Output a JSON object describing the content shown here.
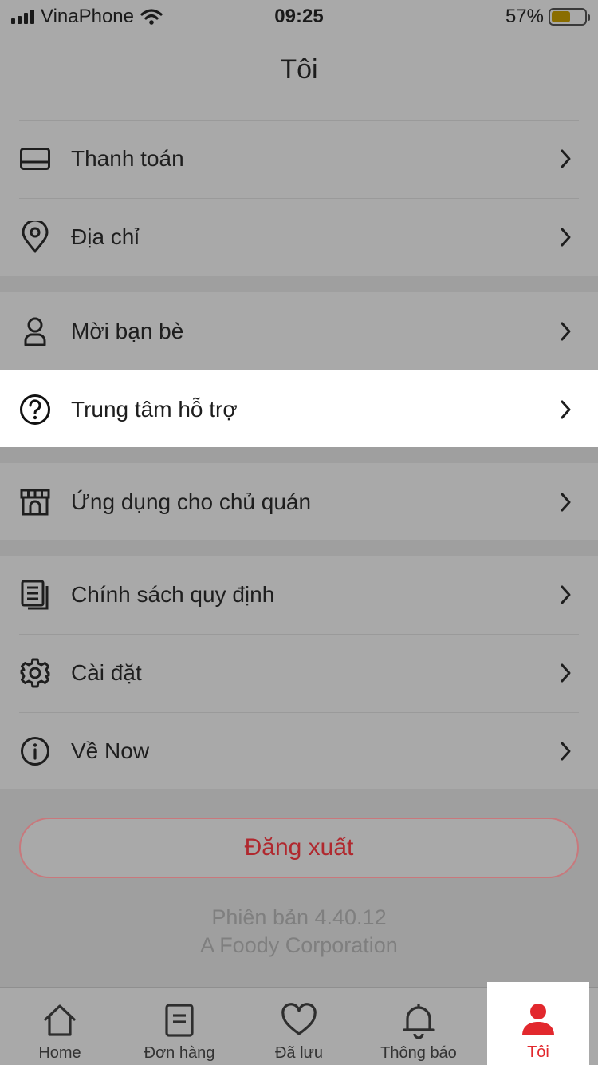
{
  "status": {
    "carrier": "VinaPhone",
    "time": "09:25",
    "battery_pct": "57%",
    "battery_level": 0.57
  },
  "header": {
    "title": "Tôi"
  },
  "menu": {
    "group1": [
      {
        "label": "Thanh toán",
        "icon": "card-icon"
      },
      {
        "label": "Địa chỉ",
        "icon": "location-pin-icon"
      }
    ],
    "group2": [
      {
        "label": "Mời bạn bè",
        "icon": "person-icon"
      },
      {
        "label": "Trung tâm hỗ trợ",
        "icon": "question-icon"
      }
    ],
    "group3": [
      {
        "label": "Ứng dụng cho chủ quán",
        "icon": "store-icon"
      }
    ],
    "group4": [
      {
        "label": "Chính sách quy định",
        "icon": "document-icon"
      },
      {
        "label": "Cài đặt",
        "icon": "gear-icon"
      },
      {
        "label": "Về Now",
        "icon": "info-icon"
      }
    ]
  },
  "logout": {
    "label": "Đăng xuất"
  },
  "footer": {
    "version": "Phiên bản 4.40.12",
    "company": "A Foody Corporation"
  },
  "tabs": [
    {
      "label": "Home",
      "icon": "home-icon"
    },
    {
      "label": "Đơn hàng",
      "icon": "order-icon"
    },
    {
      "label": "Đã lưu",
      "icon": "heart-icon"
    },
    {
      "label": "Thông báo",
      "icon": "bell-icon"
    },
    {
      "label": "Tôi",
      "icon": "profile-icon",
      "active": true
    }
  ],
  "colors": {
    "accent": "#e2282d",
    "highlight_row": "#ffffff"
  }
}
